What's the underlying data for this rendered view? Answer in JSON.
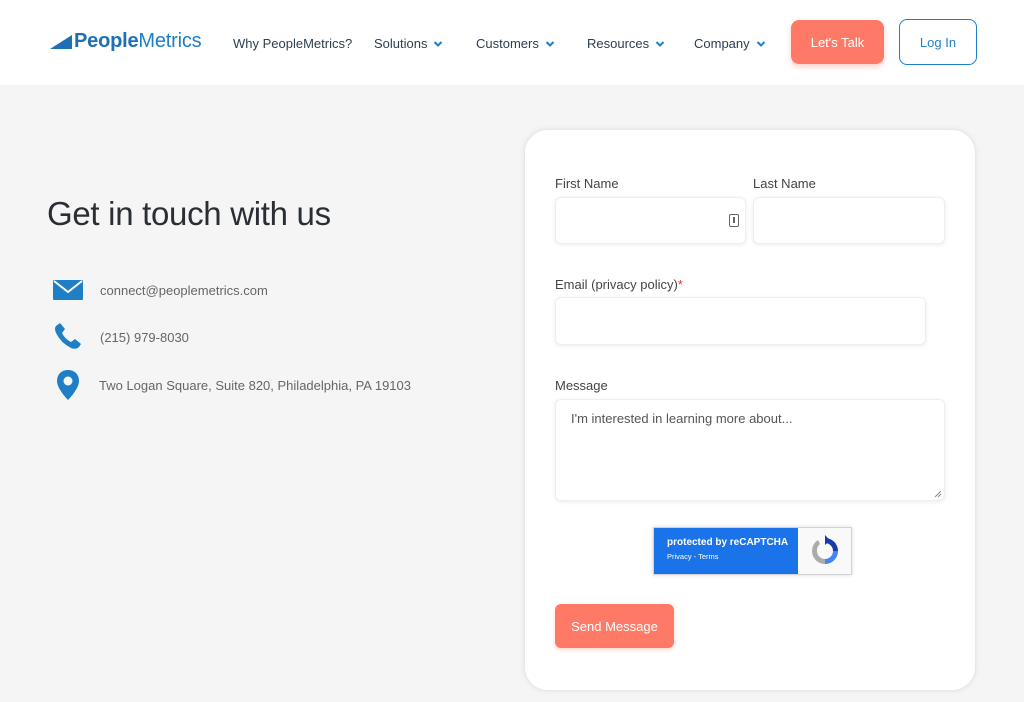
{
  "brand": {
    "logo_part1": "People",
    "logo_part2": "Metrics",
    "color": "#1e7fc6"
  },
  "nav": {
    "items": [
      {
        "label": "Why PeopleMetrics?",
        "has_dropdown": false
      },
      {
        "label": "Solutions",
        "has_dropdown": true
      },
      {
        "label": "Customers",
        "has_dropdown": true
      },
      {
        "label": "Resources",
        "has_dropdown": true
      },
      {
        "label": "Company",
        "has_dropdown": true
      }
    ],
    "cta_label": "Let's Talk",
    "login_label": "Log In"
  },
  "contact": {
    "title": "Get in touch with us",
    "email": "connect@peoplemetrics.com",
    "phone": "(215) 979-8030",
    "address": "Two Logan Square, Suite 820, Philadelphia, PA 19103"
  },
  "form": {
    "first_name_label": "First Name",
    "first_name_value": "",
    "last_name_label": "Last Name",
    "last_name_value": "",
    "email_label": "Email (privacy policy)",
    "email_required_mark": "*",
    "email_value": "",
    "message_label": "Message",
    "message_placeholder": "I'm interested in learning more about...",
    "recaptcha_text": "protected by reCAPTCHA",
    "recaptcha_links": "Privacy - Terms",
    "submit_label": "Send Message"
  },
  "colors": {
    "accent": "#ff7a66",
    "brand_blue": "#1e7fc6",
    "background": "#f5f5f5",
    "recaptcha_blue": "#1a73e8"
  },
  "icons": {
    "email": "envelope-icon",
    "phone": "phone-icon",
    "address": "map-pin-icon",
    "dropdown": "chevron-down-icon"
  }
}
